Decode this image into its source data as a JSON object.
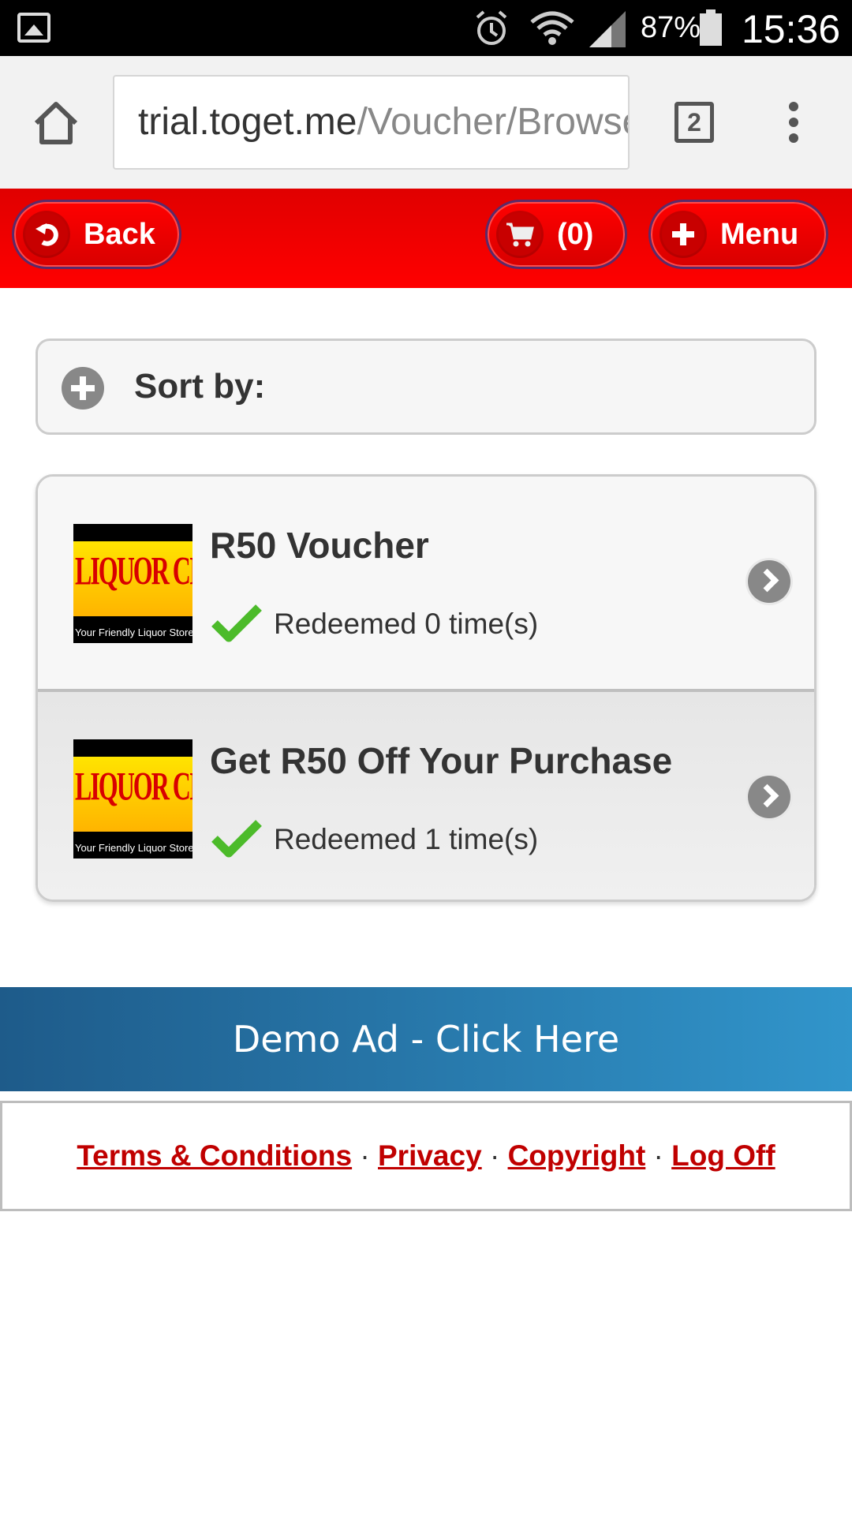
{
  "status_bar": {
    "battery_pct": "87%",
    "time": "15:36"
  },
  "browser": {
    "url_host": "trial.toget.me",
    "url_path": "/Voucher/Browse",
    "tab_count": "2"
  },
  "header": {
    "back_label": "Back",
    "cart_label": "(0)",
    "menu_label": "Menu",
    "accent_color": "#ff0000"
  },
  "sort": {
    "label": "Sort by:"
  },
  "vouchers": [
    {
      "title": "R50 Voucher",
      "status": "Redeemed 0 time(s)",
      "logo_text": "LIQUOR CITY"
    },
    {
      "title": "Get R50 Off Your Purchase",
      "status": "Redeemed 1 time(s)",
      "logo_text": "LIQUOR CITY"
    }
  ],
  "ad": {
    "label": "Demo Ad - Click Here"
  },
  "footer": {
    "links": [
      "Terms & Conditions",
      "Privacy",
      "Copyright",
      "Log Off"
    ],
    "separator": "·"
  }
}
